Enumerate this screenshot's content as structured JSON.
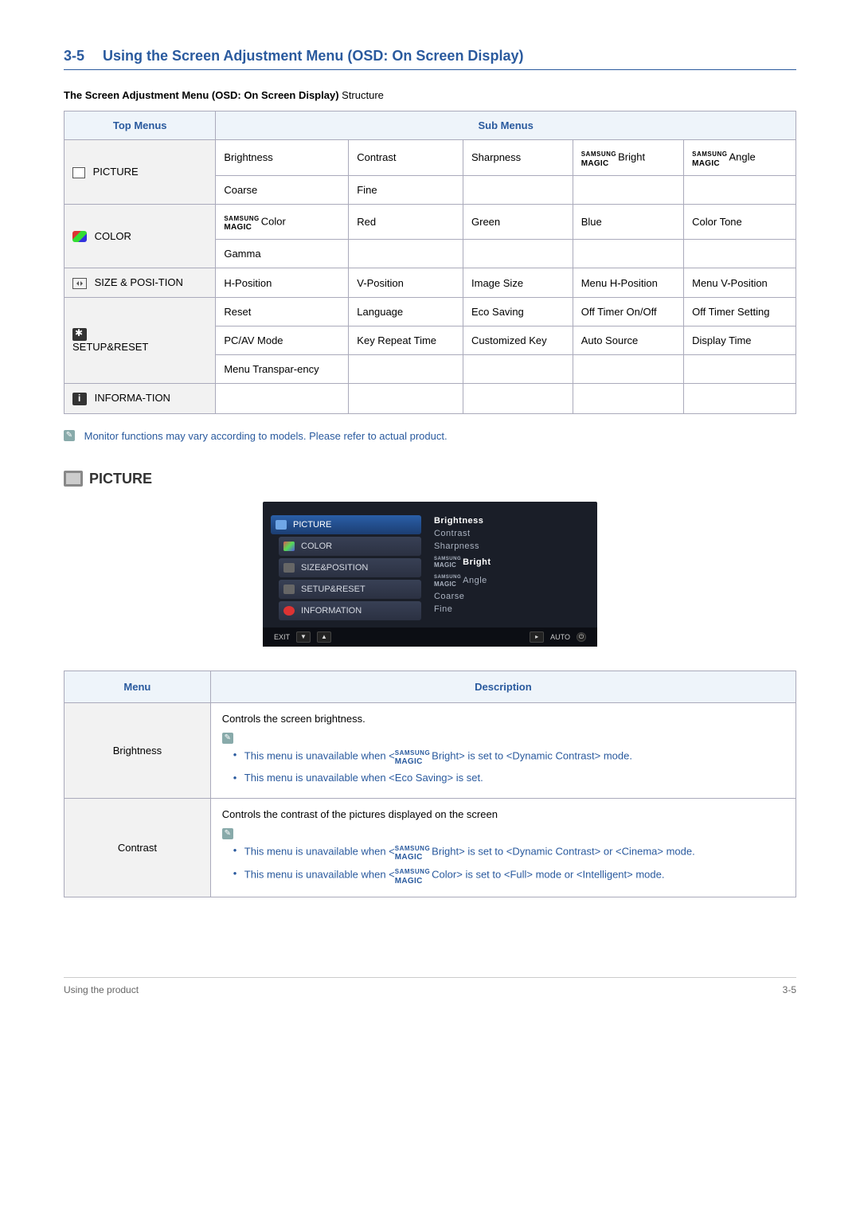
{
  "heading": {
    "number": "3-5",
    "title": "Using the Screen Adjustment Menu (OSD: On Screen Display)"
  },
  "subtitle": {
    "bold": "The Screen Adjustment Menu (OSD: On Screen Display)",
    "rest": " Structure"
  },
  "smagic": {
    "l1": "SAMSUNG",
    "l2": "MAGIC"
  },
  "table1": {
    "headers": {
      "top": "Top Menus",
      "sub": "Sub Menus"
    },
    "rows": {
      "picture": {
        "label": "PICTURE",
        "r1": {
          "c1": "Brightness",
          "c2": "Contrast",
          "c3": "Sharpness",
          "c4_suffix": "Bright",
          "c5_suffix": "Angle"
        },
        "r2": {
          "c1": "Coarse",
          "c2": "Fine"
        }
      },
      "color": {
        "label": "COLOR",
        "r1": {
          "c1_suffix": "Color",
          "c2": "Red",
          "c3": "Green",
          "c4": "Blue",
          "c5": "Color Tone"
        },
        "r2": {
          "c1": "Gamma"
        }
      },
      "size": {
        "label": "SIZE & POSI-TION",
        "r1": {
          "c1": "H-Position",
          "c2": "V-Position",
          "c3": "Image Size",
          "c4": "Menu H-Position",
          "c5": "Menu V-Position"
        }
      },
      "setup": {
        "label": "SETUP&RESET",
        "r1": {
          "c1": "Reset",
          "c2": "Language",
          "c3": "Eco Saving",
          "c4": "Off Timer On/Off",
          "c5": "Off Timer Setting"
        },
        "r2": {
          "c1": "PC/AV Mode",
          "c2": "Key Repeat Time",
          "c3": "Customized Key",
          "c4": "Auto Source",
          "c5": "Display Time"
        },
        "r3": {
          "c1": "Menu Transpar-ency"
        }
      },
      "info": {
        "label": "INFORMA-TION"
      }
    }
  },
  "note1": "Monitor functions may vary according to models. Please refer to actual product.",
  "picture_section": {
    "title": "PICTURE"
  },
  "osd": {
    "tabs": {
      "picture": "PICTURE",
      "color": "COLOR",
      "size": "SIZE&POSITION",
      "setup": "SETUP&RESET",
      "info": "INFORMATION"
    },
    "items": {
      "brightness": "Brightness",
      "contrast": "Contrast",
      "sharpness": "Sharpness",
      "bright_suffix": "Bright",
      "angle_suffix": "Angle",
      "coarse": "Coarse",
      "fine": "Fine"
    },
    "bottom": {
      "exit": "EXIT",
      "auto": "AUTO"
    }
  },
  "table2": {
    "headers": {
      "menu": "Menu",
      "desc": "Description"
    },
    "brightness": {
      "label": "Brightness",
      "desc_intro": "Controls the screen brightness.",
      "li1a": "This menu is unavailable when <",
      "li1b": "Bright> is set to <Dynamic Contrast> mode.",
      "li2": "This menu is unavailable when <Eco Saving> is set."
    },
    "contrast": {
      "label": "Contrast",
      "desc_intro": "Controls the contrast of the pictures displayed on the screen",
      "li1a": "This menu is unavailable when <",
      "li1b": "Bright> is set to <Dynamic Contrast> or <Cinema> mode.",
      "li2a": "This menu is unavailable when <",
      "li2b": "Color> is set to <Full> mode or <Intelligent> mode."
    }
  },
  "footer": {
    "left": "Using the product",
    "right": "3-5"
  }
}
